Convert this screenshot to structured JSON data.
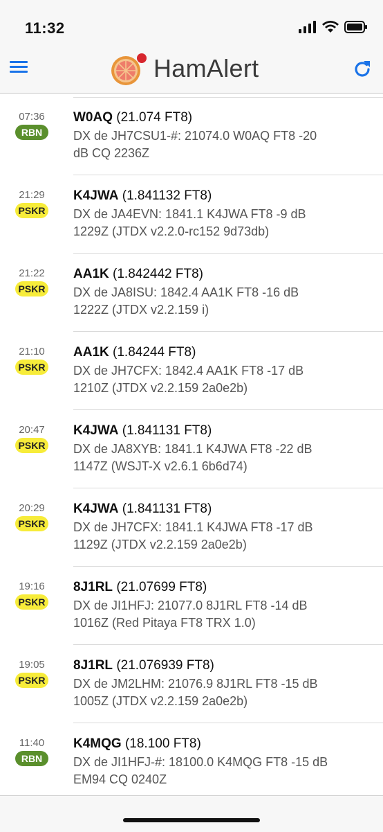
{
  "status_bar": {
    "time": "11:32",
    "icons": [
      "cellular-signal-icon",
      "wifi-icon",
      "battery-icon"
    ]
  },
  "header": {
    "title": "HamAlert",
    "menu_icon": "hamburger-menu-icon",
    "refresh_icon": "refresh-icon",
    "accent_color": "#1a73e8"
  },
  "spots": [
    {
      "time": "07:36",
      "source": "RBN",
      "call": "W0AQ",
      "detail": "(21.074 FT8)",
      "desc_line1": "DX de JH7CSU1-#: 21074.0 W0AQ FT8 -20",
      "desc_line2": "dB CQ 2236Z"
    },
    {
      "time": "21:29",
      "source": "PSKR",
      "call": "K4JWA",
      "detail": "(1.841132 FT8)",
      "desc_line1": "DX de JA4EVN: 1841.1 K4JWA FT8 -9 dB",
      "desc_line2": "1229Z (JTDX v2.2.0-rc152 9d73db)"
    },
    {
      "time": "21:22",
      "source": "PSKR",
      "call": "AA1K",
      "detail": "(1.842442 FT8)",
      "desc_line1": "DX de JA8ISU: 1842.4 AA1K FT8 -16 dB",
      "desc_line2": "1222Z (JTDX v2.2.159 i)"
    },
    {
      "time": "21:10",
      "source": "PSKR",
      "call": "AA1K",
      "detail": "(1.84244 FT8)",
      "desc_line1": "DX de JH7CFX: 1842.4 AA1K FT8 -17 dB",
      "desc_line2": "1210Z (JTDX v2.2.159 2a0e2b)"
    },
    {
      "time": "20:47",
      "source": "PSKR",
      "call": "K4JWA",
      "detail": "(1.841131 FT8)",
      "desc_line1": "DX de JA8XYB: 1841.1 K4JWA FT8 -22 dB",
      "desc_line2": "1147Z (WSJT-X v2.6.1 6b6d74)"
    },
    {
      "time": "20:29",
      "source": "PSKR",
      "call": "K4JWA",
      "detail": "(1.841131 FT8)",
      "desc_line1": "DX de JH7CFX: 1841.1 K4JWA FT8 -17 dB",
      "desc_line2": "1129Z (JTDX v2.2.159 2a0e2b)"
    },
    {
      "time": "19:16",
      "source": "PSKR",
      "call": "8J1RL",
      "detail": "(21.07699 FT8)",
      "desc_line1": "DX de JI1HFJ: 21077.0 8J1RL FT8 -14 dB",
      "desc_line2": "1016Z (Red Pitaya FT8 TRX 1.0)"
    },
    {
      "time": "19:05",
      "source": "PSKR",
      "call": "8J1RL",
      "detail": "(21.076939 FT8)",
      "desc_line1": "DX de JM2LHM: 21076.9 8J1RL FT8 -15 dB",
      "desc_line2": "1005Z (JTDX v2.2.159 2a0e2b)"
    },
    {
      "time": "11:40",
      "source": "RBN",
      "call": "K4MQG",
      "detail": "(18.100 FT8)",
      "desc_line1": "DX de JI1HFJ-#: 18100.0 K4MQG FT8 -15 dB",
      "desc_line2": "EM94 CQ 0240Z"
    }
  ],
  "badge_colors": {
    "RBN": "#5a8f2c",
    "PSKR": "#f7ec3a"
  }
}
